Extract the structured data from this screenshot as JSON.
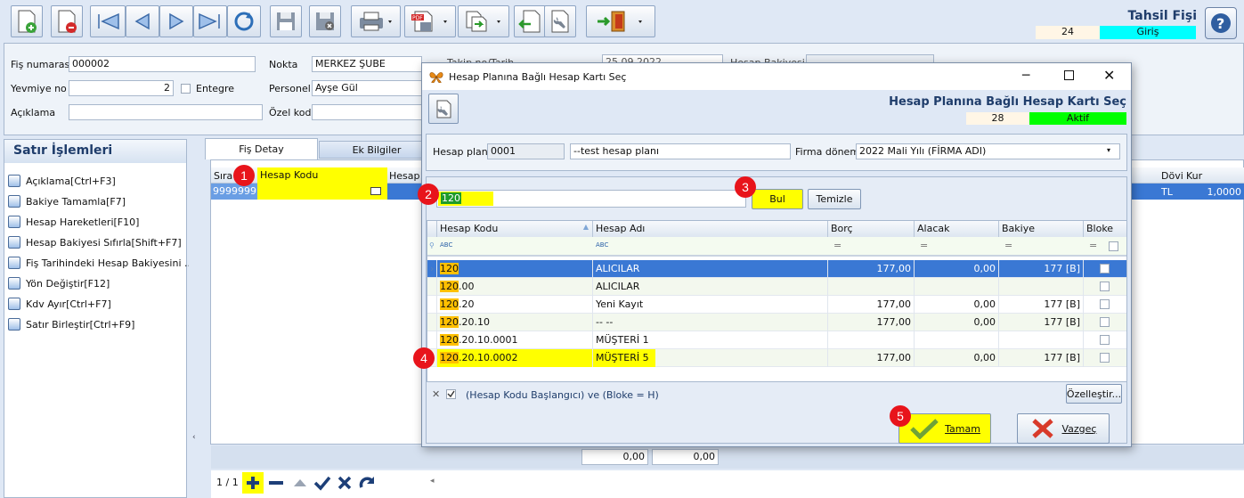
{
  "header": {
    "title": "Tahsil Fişi",
    "record_no": "24",
    "mode": "Giriş",
    "help_icon": "help-icon"
  },
  "toolbar": {
    "icons": [
      "new-document-icon",
      "delete-document-icon",
      "first-icon",
      "previous-icon",
      "next-icon",
      "last-icon",
      "refresh-icon",
      "save-icon",
      "save-close-icon",
      "print-icon",
      "pdf-export-icon",
      "copy-icon",
      "import-icon",
      "tools-icon",
      "exit-icon"
    ]
  },
  "form": {
    "fis_label": "Fiş numarası",
    "fis_value": "000002",
    "yevmiye_label": "Yevmiye no",
    "yevmiye_value": "2",
    "entegre_label": "Entegre",
    "aciklama_label": "Açıklama",
    "nokta_label": "Nokta",
    "nokta_value": "MERKEZ ŞUBE",
    "personel_label": "Personel",
    "personel_value": "Ayşe Gül",
    "ozelkod_label": "Özel kod",
    "takip_label": "Takip no/Tarih",
    "tarih_value": "25.09.2022",
    "bakiye_label": "Hesap Bakiyesi"
  },
  "left_panel": {
    "title": "Satır İşlemleri",
    "items": [
      "Açıklama[Ctrl+F3]",
      "Bakiye Tamamla[F7]",
      "Hesap Hareketleri[F10]",
      "Hesap Bakiyesi Sıfırla[Shift+F7]",
      "Fiş Tarihindeki Hesap Bakiyesini ...",
      "Yön Değiştir[F12]",
      "Kdv Ayır[Ctrl+F7]",
      "Satır Birleştir[Ctrl+F9]"
    ]
  },
  "tabs": [
    "Fiş Detay",
    "Ek Bilgiler"
  ],
  "main_grid": {
    "col_sira": "Sıra",
    "col_hesap": "Hesap Kodu",
    "col_hesapad": "Hesap A",
    "col_doviz": "Dövi",
    "col_kur": "Kur",
    "row_sira": "9999999",
    "row_doviz": "TL",
    "row_kur": "1,0000"
  },
  "footer": {
    "total1": "0,00",
    "total2": "0,00",
    "pager": "1 / 1"
  },
  "badges": [
    "1",
    "2",
    "3",
    "4",
    "5"
  ],
  "dialog": {
    "window_title": "Hesap Planına Bağlı Hesap Kartı Seç",
    "heading": "Hesap Planına Bağlı Hesap Kartı Seç",
    "record_no": "28",
    "status": "Aktif",
    "plan_label": "Hesap planı",
    "plan_code": "0001",
    "plan_name": "--test hesap planı",
    "donem_label": "Firma dönemi",
    "donem_value": "2022 Mali Yılı (FİRMA ADI)",
    "search_value": "120",
    "find_label": "Bul",
    "clear_label": "Temizle",
    "columns": [
      "Hesap Kodu",
      "Hesap Adı",
      "Borç",
      "Alacak",
      "Bakiye",
      "Bloke"
    ],
    "rows": [
      {
        "pre": "120",
        "post": "",
        "name": "ALICILAR",
        "borc": "177,00",
        "alacak": "0,00",
        "bakiye": "177 [B]"
      },
      {
        "pre": "120",
        "post": ".00",
        "name": "ALICILAR",
        "borc": "",
        "alacak": "",
        "bakiye": ""
      },
      {
        "pre": "120",
        "post": ".20",
        "name": "Yeni Kayıt",
        "borc": "177,00",
        "alacak": "0,00",
        "bakiye": "177 [B]"
      },
      {
        "pre": "120",
        "post": ".20.10",
        "name": "-- --",
        "borc": "177,00",
        "alacak": "0,00",
        "bakiye": "177 [B]"
      },
      {
        "pre": "120",
        "post": ".20.10.0001",
        "name": "MÜŞTERİ 1",
        "borc": "",
        "alacak": "",
        "bakiye": ""
      },
      {
        "pre": "120",
        "post": ".20.10.0002",
        "name": "MÜŞTERİ 5",
        "borc": "177,00",
        "alacak": "0,00",
        "bakiye": "177 [B]"
      }
    ],
    "filter_text": "(Hesap Kodu Başlangıcı) ve (Bloke = H)",
    "customize_label": "Özelleştir...",
    "ok_label": "Tamam",
    "cancel_label": "Vazgeç"
  },
  "colors": {
    "accent_yellow": "#ffff00",
    "match": "#ffc000",
    "status_cyan": "#00ffff",
    "status_green": "#00ff00",
    "selected_row": "#3a78d4"
  }
}
